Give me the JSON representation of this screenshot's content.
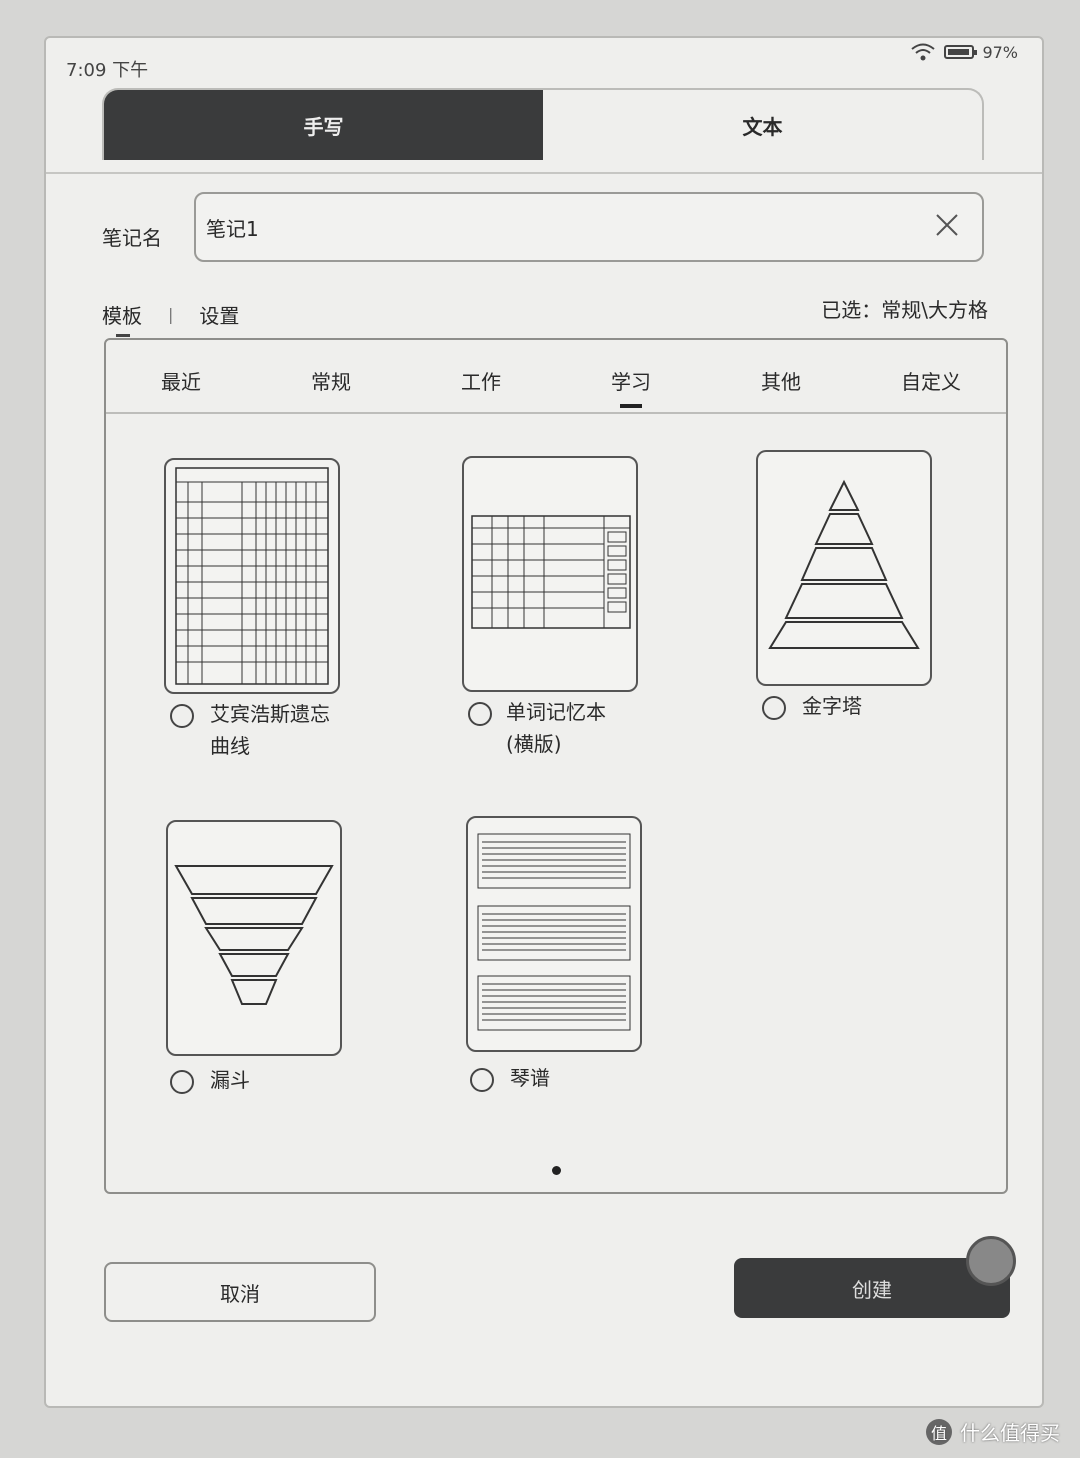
{
  "status": {
    "time": "7:09 下午",
    "battery": "97%"
  },
  "mode_tabs": [
    {
      "label": "手写",
      "active": true
    },
    {
      "label": "文本",
      "active": false
    }
  ],
  "note_name": {
    "label": "笔记名",
    "value": "笔记1"
  },
  "sub_tabs": {
    "template": "模板",
    "settings": "设置"
  },
  "selected": "已选：常规\\大方格",
  "categories": [
    {
      "label": "最近"
    },
    {
      "label": "常规"
    },
    {
      "label": "工作"
    },
    {
      "label": "学习",
      "active": true
    },
    {
      "label": "其他"
    },
    {
      "label": "自定义"
    }
  ],
  "templates": [
    {
      "line1": "艾宾浩斯遗忘",
      "line2": "曲线"
    },
    {
      "line1": "单词记忆本",
      "line2": "(横版)"
    },
    {
      "line1": "金字塔",
      "line2": ""
    },
    {
      "line1": "漏斗",
      "line2": ""
    },
    {
      "line1": "琴谱",
      "line2": ""
    }
  ],
  "buttons": {
    "cancel": "取消",
    "create": "创建"
  },
  "watermark": "什么值得买"
}
